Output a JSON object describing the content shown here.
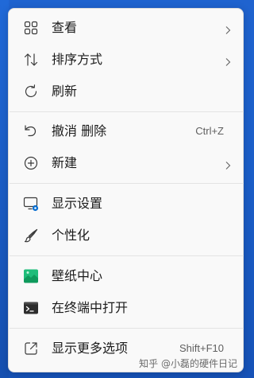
{
  "menu": {
    "items": [
      {
        "label": "查看",
        "icon": "grid-icon",
        "submenu": true
      },
      {
        "label": "排序方式",
        "icon": "sort-arrows-icon",
        "submenu": true
      },
      {
        "label": "刷新",
        "icon": "refresh-icon"
      },
      {
        "label": "撤消 删除",
        "icon": "undo-icon",
        "shortcut": "Ctrl+Z"
      },
      {
        "label": "新建",
        "icon": "add-circle-icon",
        "submenu": true
      },
      {
        "label": "显示设置",
        "icon": "display-settings-icon"
      },
      {
        "label": "个性化",
        "icon": "brush-icon"
      },
      {
        "label": "壁纸中心",
        "icon": "wallpaper-center-icon"
      },
      {
        "label": "在终端中打开",
        "icon": "terminal-icon"
      },
      {
        "label": "显示更多选项",
        "icon": "open-external-icon",
        "shortcut": "Shift+F10"
      }
    ]
  },
  "watermark": "知乎 @小磊的硬件日记",
  "colors": {
    "menu_background": "#f9f9f9",
    "accent": "#0067c0",
    "wallpaper": "#1b5ec8"
  }
}
